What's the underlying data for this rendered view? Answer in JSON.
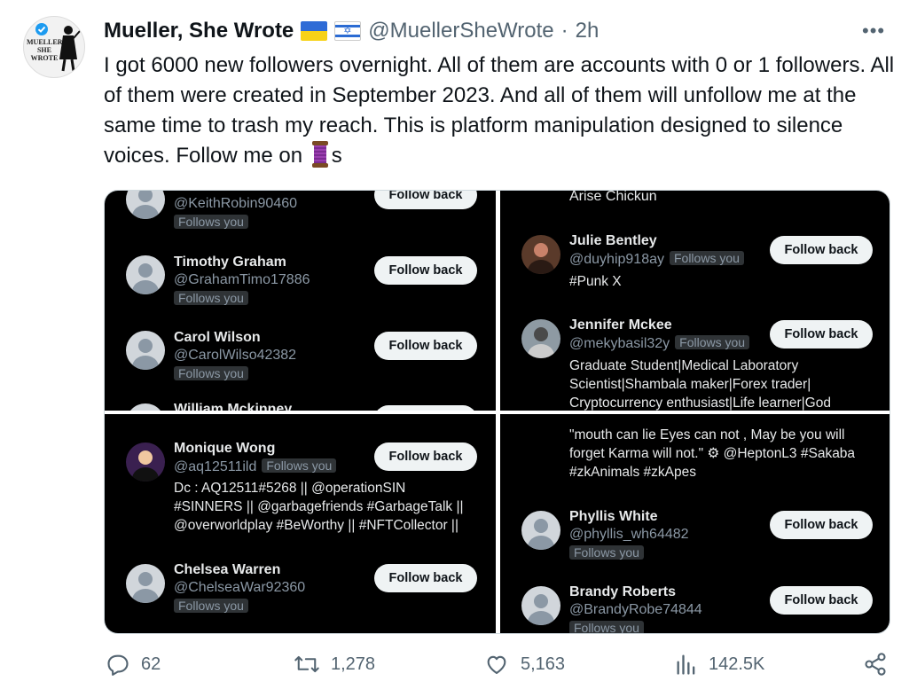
{
  "tweet": {
    "author_name": "Mueller, She Wrote",
    "avatar_text": "MUELLER SHE WROTE",
    "flags": [
      "ukraine-flag-icon",
      "israel-flag-icon"
    ],
    "handle": "@MuellerSheWrote",
    "separator": "·",
    "time": "2h",
    "more_label": "•••",
    "text_main": "I got 6000 new followers overnight. All of them are accounts with 0 or 1 followers. All of them were created in September 2023. And all of them will unfollow me at the same time to trash my reach. This is platform manipulation designed to silence voices. Follow me on",
    "text_emoji": "spool-of-thread-icon",
    "text_tail": "s"
  },
  "media": {
    "follows_you": "Follows you",
    "follow_back": "Follow back",
    "panel1": {
      "top_handle": "@KeithRobin90460",
      "users": [
        {
          "name": "Timothy Graham",
          "handle": "@GrahamTimo17886"
        },
        {
          "name": "Carol Wilson",
          "handle": "@CarolWilso42382"
        }
      ],
      "cut_name": "William Mckinney"
    },
    "panel2": {
      "top_text": "Arise Chickun",
      "users": [
        {
          "name": "Julie Bentley",
          "handle": "@duyhip918ay",
          "bio": "#Punk X"
        },
        {
          "name": "Jennifer Mckee",
          "handle": "@mekybasil32y",
          "bio": "Graduate Student|Medical Laboratory Scientist|Shambala maker|Forex trader| Cryptocurrency enthusiast|Life learner|God"
        }
      ]
    },
    "panel3": {
      "users": [
        {
          "name": "Monique Wong",
          "handle": "@aq12511ild",
          "bio": "Dc : AQ12511#5268 || @operationSIN #SINNERS || @garbagefriends #GarbageTalk || @overworldplay #BeWorthy || #NFTCollector ||"
        },
        {
          "name": "Chelsea Warren",
          "handle": "@ChelseaWar92360"
        }
      ]
    },
    "panel4": {
      "top_bio": "\"mouth can lie Eyes can not , May be you will forget Karma will not.\" ⚙ @HeptonL3 #Sakaba #zkAnimals #zkApes",
      "users": [
        {
          "name": "Phyllis White",
          "handle": "@phyllis_wh64482"
        },
        {
          "name": "Brandy Roberts",
          "handle": "@BrandyRobe74844"
        }
      ]
    }
  },
  "actions": {
    "replies": "62",
    "retweets": "1,278",
    "likes": "5,163",
    "views": "142.5K"
  },
  "colors": {
    "accent": "#1d9bf0",
    "text": "#0f1419",
    "muted": "#536471",
    "panel_bg": "#000000"
  }
}
